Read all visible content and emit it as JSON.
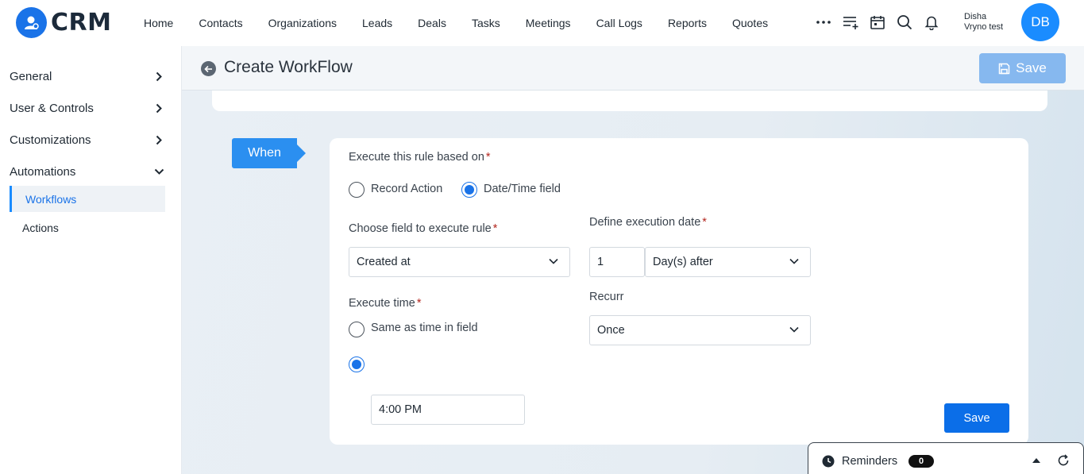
{
  "app": {
    "logo_text": "CRM"
  },
  "nav": {
    "items": [
      "Home",
      "Contacts",
      "Organizations",
      "Leads",
      "Deals",
      "Tasks",
      "Meetings",
      "Call Logs",
      "Reports",
      "Quotes"
    ]
  },
  "user": {
    "name": "Disha",
    "org": "Vryno test",
    "initials": "DB"
  },
  "sidebar": {
    "general": "General",
    "user_controls": "User & Controls",
    "customizations": "Customizations",
    "automations": "Automations",
    "workflows": "Workflows",
    "actions": "Actions"
  },
  "header": {
    "title": "Create WorkFlow",
    "save_label": "Save"
  },
  "when": {
    "tag": "When",
    "execute_based_on": "Execute this rule based on",
    "record_action": "Record Action",
    "date_time_field": "Date/Time field",
    "selected_basis": "Date/Time field",
    "choose_field_label": "Choose field to execute rule",
    "choose_field_value": "Created at",
    "define_date_label": "Define execution date",
    "day_count": "1",
    "day_relation": "Day(s) after",
    "execute_time_label": "Execute time",
    "same_as_field": "Same as time in field",
    "time_value": "4:00 PM",
    "recurr_label": "Recurr",
    "recurr_value": "Once",
    "save_label": "Save",
    "required_mark": "*"
  },
  "reminders": {
    "label": "Reminders",
    "count": "0"
  },
  "colors": {
    "primary": "#1a73e8",
    "save_disabled": "#86b8ef",
    "when_tag": "#2b8ff0"
  }
}
